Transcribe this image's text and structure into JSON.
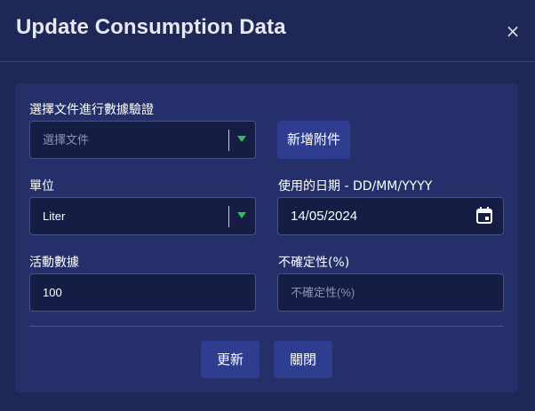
{
  "dialog": {
    "title": "Update Consumption Data",
    "close_icon": "×"
  },
  "form": {
    "document": {
      "label": "選擇文件進行數據驗證",
      "placeholder": "選擇文件"
    },
    "add_attachment_label": "新增附件",
    "unit": {
      "label": "單位",
      "value": "Liter"
    },
    "date": {
      "label": "使用的日期 - DD/MM/YYYY",
      "value": "14/05/2024"
    },
    "activity": {
      "label": "活動數據",
      "value": "100"
    },
    "uncertainty": {
      "label": "不確定性(%)",
      "placeholder": "不確定性(%)"
    }
  },
  "actions": {
    "update_label": "更新",
    "close_label": "關閉"
  },
  "colors": {
    "background": "#1f2757",
    "card": "#25306a",
    "field": "#151d45",
    "button": "#2e3d8f",
    "caret": "#2bc45a"
  },
  "icons": [
    "close-icon",
    "chevron-down-icon",
    "calendar-icon"
  ]
}
